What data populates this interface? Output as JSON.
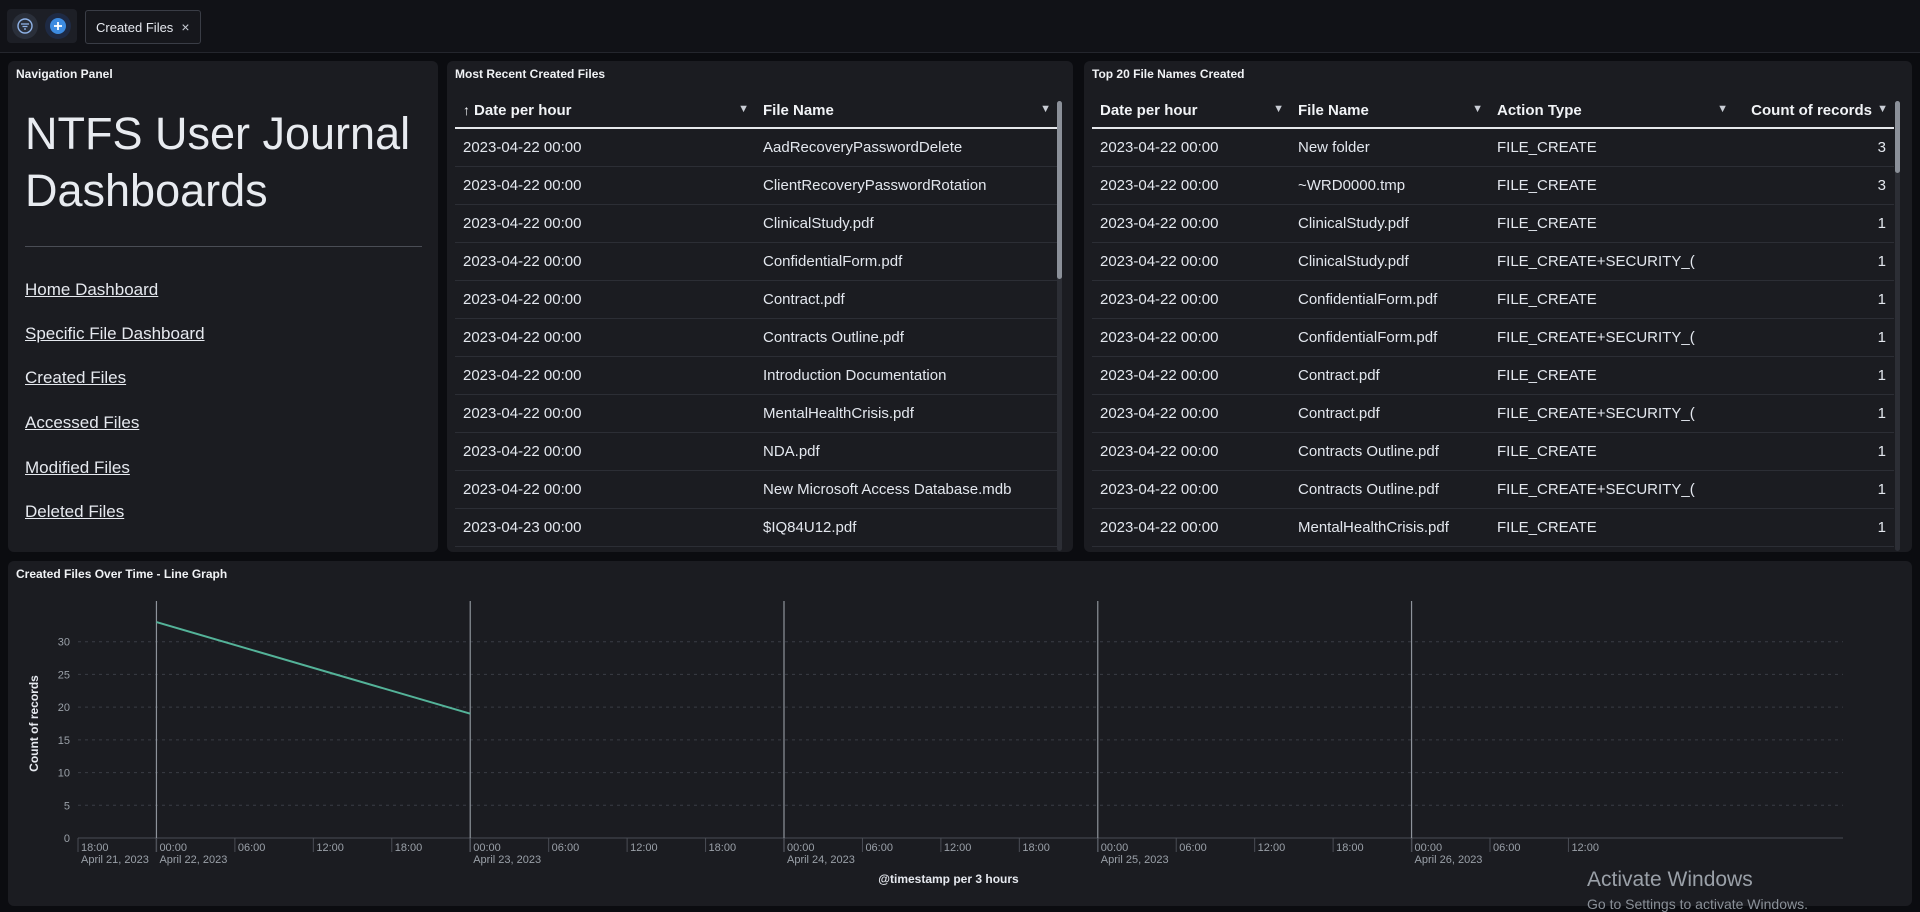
{
  "toolbar": {
    "filter_icon": "filter-icon",
    "add_icon": "plus-icon",
    "tab_label": "Created Files",
    "tab_close": "×"
  },
  "nav_panel": {
    "title": "Navigation Panel",
    "heading_line1": "NTFS User Journal",
    "heading_line2": "Dashboards",
    "links": [
      "Home Dashboard",
      "Specific File Dashboard",
      "Created Files",
      "Accessed Files",
      "Modified Files",
      "Deleted Files"
    ]
  },
  "recent_panel": {
    "title": "Most Recent Created Files",
    "columns": [
      "Date per hour",
      "File Name"
    ],
    "rows": [
      [
        "2023-04-22 00:00",
        "AadRecoveryPasswordDelete"
      ],
      [
        "2023-04-22 00:00",
        "ClientRecoveryPasswordRotation"
      ],
      [
        "2023-04-22 00:00",
        "ClinicalStudy.pdf"
      ],
      [
        "2023-04-22 00:00",
        "ConfidentialForm.pdf"
      ],
      [
        "2023-04-22 00:00",
        "Contract.pdf"
      ],
      [
        "2023-04-22 00:00",
        "Contracts Outline.pdf"
      ],
      [
        "2023-04-22 00:00",
        "Introduction Documentation"
      ],
      [
        "2023-04-22 00:00",
        "MentalHealthCrisis.pdf"
      ],
      [
        "2023-04-22 00:00",
        "NDA.pdf"
      ],
      [
        "2023-04-22 00:00",
        "New Microsoft Access Database.mdb"
      ],
      [
        "2023-04-23 00:00",
        "$IQ84U12.pdf"
      ]
    ]
  },
  "top20_panel": {
    "title": "Top 20 File Names Created",
    "columns": [
      "Date per hour",
      "File Name",
      "Action Type",
      "Count of records"
    ],
    "rows": [
      [
        "2023-04-22 00:00",
        "New folder",
        "FILE_CREATE",
        "3"
      ],
      [
        "2023-04-22 00:00",
        "~WRD0000.tmp",
        "FILE_CREATE",
        "3"
      ],
      [
        "2023-04-22 00:00",
        "ClinicalStudy.pdf",
        "FILE_CREATE",
        "1"
      ],
      [
        "2023-04-22 00:00",
        "ClinicalStudy.pdf",
        "FILE_CREATE+SECURITY_(",
        "1"
      ],
      [
        "2023-04-22 00:00",
        "ConfidentialForm.pdf",
        "FILE_CREATE",
        "1"
      ],
      [
        "2023-04-22 00:00",
        "ConfidentialForm.pdf",
        "FILE_CREATE+SECURITY_(",
        "1"
      ],
      [
        "2023-04-22 00:00",
        "Contract.pdf",
        "FILE_CREATE",
        "1"
      ],
      [
        "2023-04-22 00:00",
        "Contract.pdf",
        "FILE_CREATE+SECURITY_(",
        "1"
      ],
      [
        "2023-04-22 00:00",
        "Contracts Outline.pdf",
        "FILE_CREATE",
        "1"
      ],
      [
        "2023-04-22 00:00",
        "Contracts Outline.pdf",
        "FILE_CREATE+SECURITY_(",
        "1"
      ],
      [
        "2023-04-22 00:00",
        "MentalHealthCrisis.pdf",
        "FILE_CREATE",
        "1"
      ]
    ]
  },
  "chart_data": {
    "type": "line",
    "title": "Created Files Over Time - Line Graph",
    "xlabel": "@timestamp per 3 hours",
    "ylabel": "Count of records",
    "ylim": [
      0,
      35
    ],
    "yticks": [
      0,
      5,
      10,
      15,
      20,
      25,
      30
    ],
    "xlim_hours": [
      -6,
      129
    ],
    "xticks": [
      {
        "h": -6,
        "label": "18:00",
        "sub": "April 21, 2023"
      },
      {
        "h": 0,
        "label": "00:00",
        "sub": "April 22, 2023"
      },
      {
        "h": 6,
        "label": "06:00",
        "sub": ""
      },
      {
        "h": 12,
        "label": "12:00",
        "sub": ""
      },
      {
        "h": 18,
        "label": "18:00",
        "sub": ""
      },
      {
        "h": 24,
        "label": "00:00",
        "sub": "April 23, 2023"
      },
      {
        "h": 30,
        "label": "06:00",
        "sub": ""
      },
      {
        "h": 36,
        "label": "12:00",
        "sub": ""
      },
      {
        "h": 42,
        "label": "18:00",
        "sub": ""
      },
      {
        "h": 48,
        "label": "00:00",
        "sub": "April 24, 2023"
      },
      {
        "h": 54,
        "label": "06:00",
        "sub": ""
      },
      {
        "h": 60,
        "label": "12:00",
        "sub": ""
      },
      {
        "h": 66,
        "label": "18:00",
        "sub": ""
      },
      {
        "h": 72,
        "label": "00:00",
        "sub": "April 25, 2023"
      },
      {
        "h": 78,
        "label": "06:00",
        "sub": ""
      },
      {
        "h": 84,
        "label": "12:00",
        "sub": ""
      },
      {
        "h": 90,
        "label": "18:00",
        "sub": ""
      },
      {
        "h": 96,
        "label": "00:00",
        "sub": "April 26, 2023"
      },
      {
        "h": 102,
        "label": "06:00",
        "sub": ""
      },
      {
        "h": 108,
        "label": "12:00",
        "sub": ""
      }
    ],
    "day_boundaries_hours": [
      0,
      24,
      48,
      72,
      96
    ],
    "series": [
      {
        "x_hours": [
          0,
          24
        ],
        "values": [
          33,
          19
        ],
        "color": "#54b399"
      }
    ],
    "grid": true
  },
  "watermark": {
    "line1": "Activate Windows",
    "line2": "Go to Settings to activate Windows."
  }
}
